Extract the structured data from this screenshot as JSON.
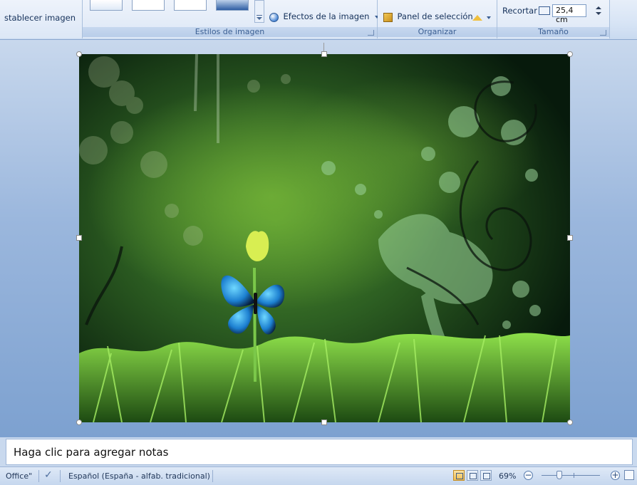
{
  "ribbon": {
    "reset_image_label": "stablecer imagen",
    "image_styles": {
      "group_label": "Estilos de imagen",
      "effects_label": "Efectos de la imagen"
    },
    "arrange": {
      "group_label": "Organizar",
      "selection_pane_label": "Panel de selección"
    },
    "size": {
      "group_label": "Tamaño",
      "crop_label": "Recortar",
      "width_value": "25,4 cm"
    }
  },
  "notes": {
    "placeholder": "Haga clic para agregar notas"
  },
  "status": {
    "theme": "Office\"",
    "language": "Español (España - alfab. tradicional)",
    "zoom_level": "69%",
    "zoom_fraction": 0.3
  }
}
